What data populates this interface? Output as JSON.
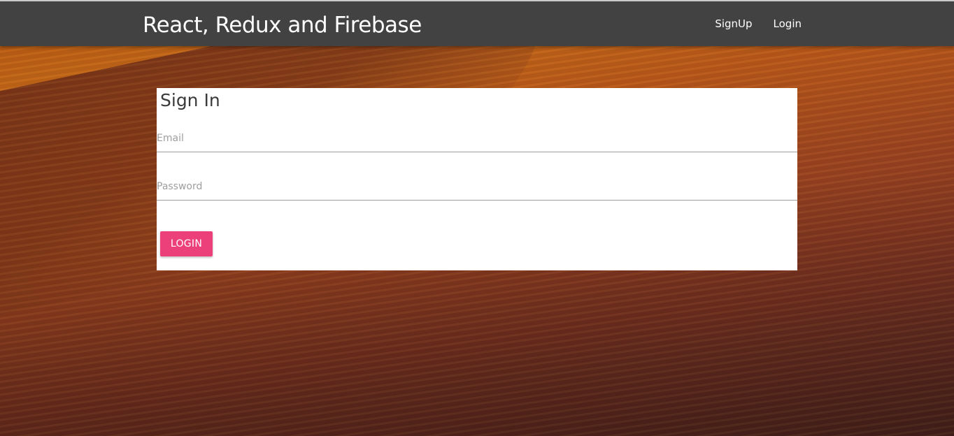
{
  "navbar": {
    "brand": "React, Redux and Firebase",
    "links": [
      "SignUp",
      "Login"
    ]
  },
  "signin": {
    "title": "Sign In",
    "email_placeholder": "Email",
    "password_placeholder": "Password",
    "submit_label": "LOGIN"
  },
  "colors": {
    "navbar_bg": "#424242",
    "button_bg": "#ec407a",
    "card_bg": "#ffffff"
  }
}
